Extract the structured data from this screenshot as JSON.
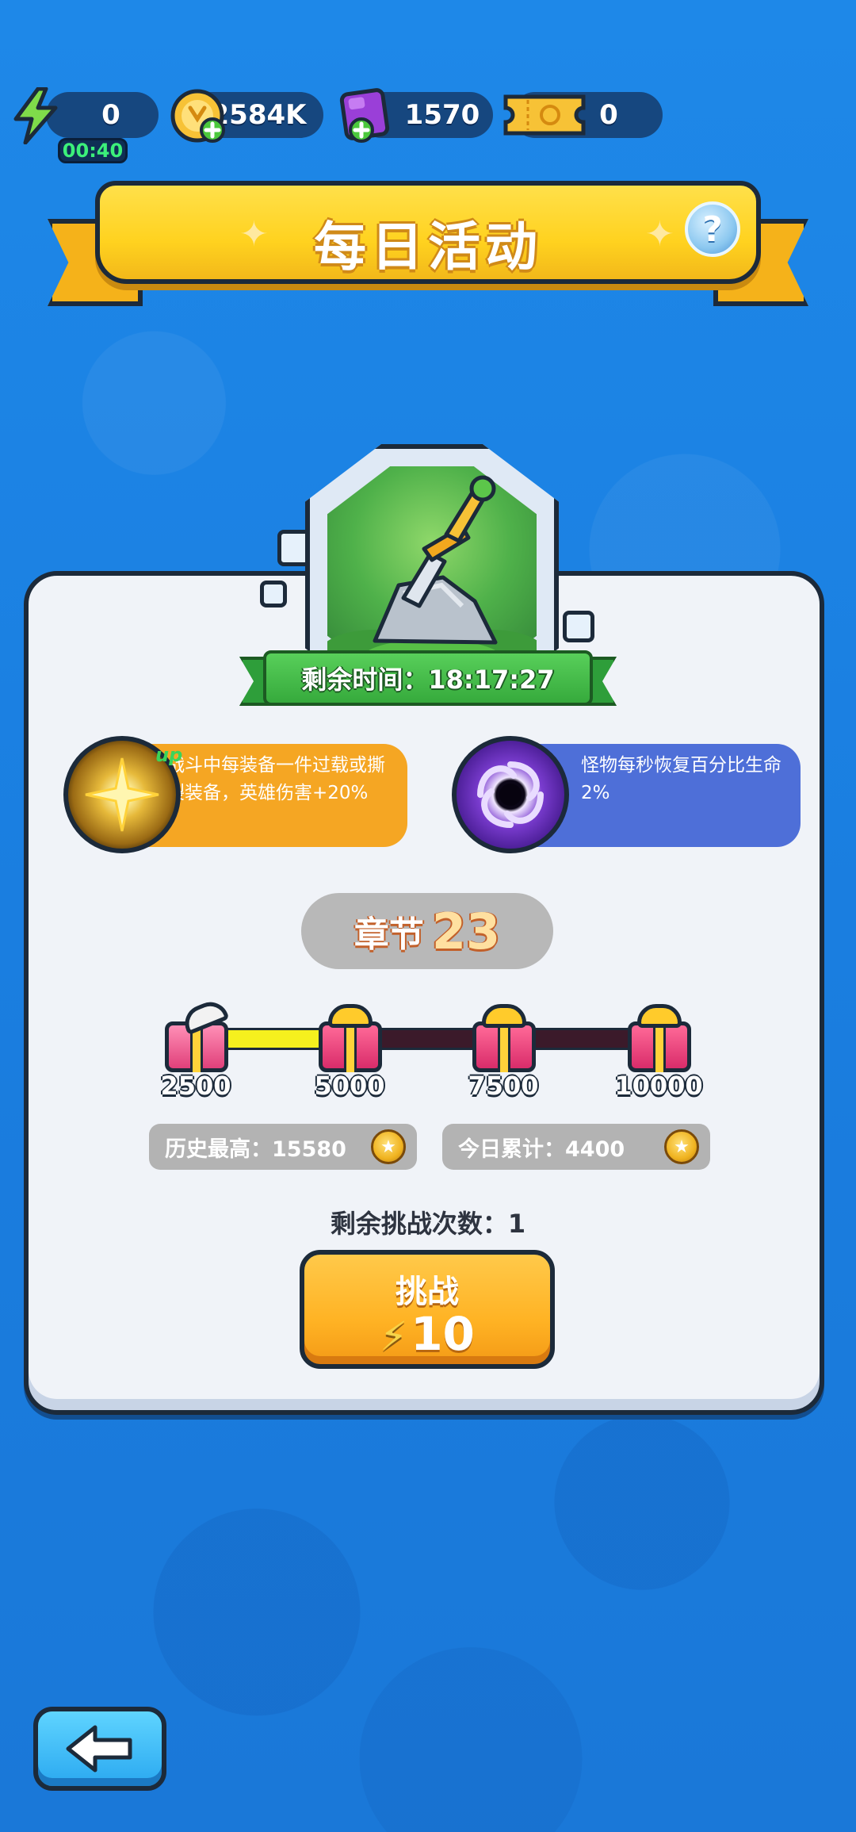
{
  "resources": {
    "energy": {
      "value": "0",
      "timer": "00:40",
      "icon": "lightning-icon"
    },
    "gold": {
      "value": "2584K",
      "icon": "gold-coin-add-icon"
    },
    "gems": {
      "value": "1570",
      "icon": "purple-gem-add-icon"
    },
    "tickets": {
      "value": "0",
      "icon": "golden-ticket-icon"
    }
  },
  "header": {
    "title": "每日活动",
    "help": "?"
  },
  "stage": {
    "icon": "sword-in-stone-icon",
    "remaining_time_label": "剩余时间：18:17:27"
  },
  "buffs": [
    {
      "text": "战斗中每装备一件过载或撕裂装备，英雄伤害+20%",
      "tag": "up",
      "icon": "golden-sparkle-icon",
      "color": "#f5a623"
    },
    {
      "text": "怪物每秒恢复百分比生命2%",
      "icon": "black-hole-vortex-icon",
      "color": "#4e6fd8"
    }
  ],
  "chapter": {
    "label": "章节",
    "number": "23"
  },
  "progress": {
    "current": 4400,
    "max": 10000,
    "milestones": [
      "2500",
      "5000",
      "7500",
      "10000"
    ],
    "claimed": [
      true,
      false,
      false,
      false
    ]
  },
  "stats": {
    "best": "历史最高：15580",
    "today": "今日累计：4400"
  },
  "attempts_label": "剩余挑战次数：1",
  "challenge": {
    "label": "挑战",
    "cost": "10"
  },
  "colors": {
    "background": "#1f86e3",
    "accent": "#ffb324",
    "progress_fill": "#f5f01e"
  }
}
